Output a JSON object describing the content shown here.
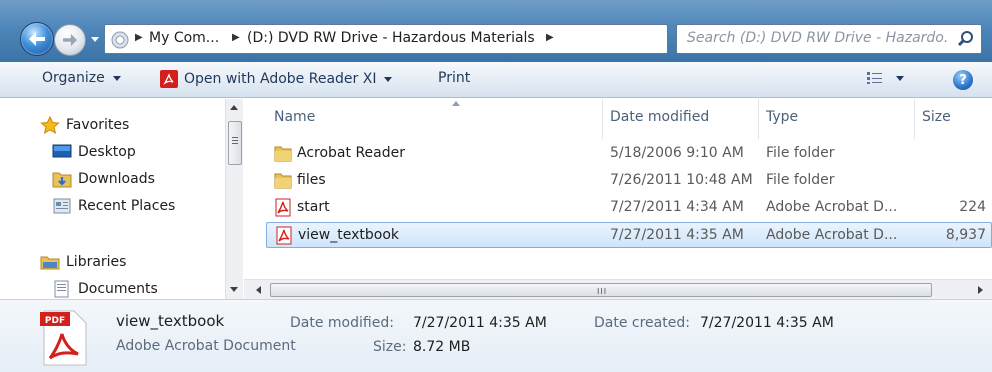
{
  "address_bar": {
    "crumbs": [
      "My Com...",
      "(D:) DVD RW Drive - Hazardous Materials"
    ],
    "search_placeholder": "Search (D:) DVD RW Drive - Hazardo..."
  },
  "toolbar": {
    "organize_label": "Organize",
    "open_with_label": "Open with Adobe Reader XI",
    "print_label": "Print"
  },
  "nav": {
    "favorites_label": "Favorites",
    "favorites": [
      "Desktop",
      "Downloads",
      "Recent Places"
    ],
    "libraries_label": "Libraries",
    "libraries": [
      "Documents"
    ]
  },
  "file_list": {
    "columns": [
      "Name",
      "Date modified",
      "Type",
      "Size"
    ],
    "rows": [
      {
        "name": "Acrobat Reader",
        "date": "5/18/2006 9:10 AM",
        "type": "File folder",
        "size": "",
        "icon": "folder-icon"
      },
      {
        "name": "files",
        "date": "7/26/2011 10:48 AM",
        "type": "File folder",
        "size": "",
        "icon": "folder-icon"
      },
      {
        "name": "start",
        "date": "7/27/2011 4:34 AM",
        "type": "Adobe Acrobat D...",
        "size": "224",
        "icon": "pdf-file-icon"
      },
      {
        "name": "view_textbook",
        "date": "7/27/2011 4:35 AM",
        "type": "Adobe Acrobat D...",
        "size": "8,937",
        "icon": "pdf-file-icon",
        "selected": true
      }
    ]
  },
  "details": {
    "name": "view_textbook",
    "type": "Adobe Acrobat Document",
    "date_modified_label": "Date modified:",
    "date_modified": "7/27/2011 4:35 AM",
    "date_created_label": "Date created:",
    "date_created": "7/27/2011 4:35 AM",
    "size_label": "Size:",
    "size": "8.72 MB",
    "pdf_badge": "PDF"
  },
  "colors": {
    "title_gradient": "#4f86b9",
    "selection": "#cfe5fb",
    "pdf_red": "#d4201d",
    "folder_yellow": "#e8c25a"
  }
}
